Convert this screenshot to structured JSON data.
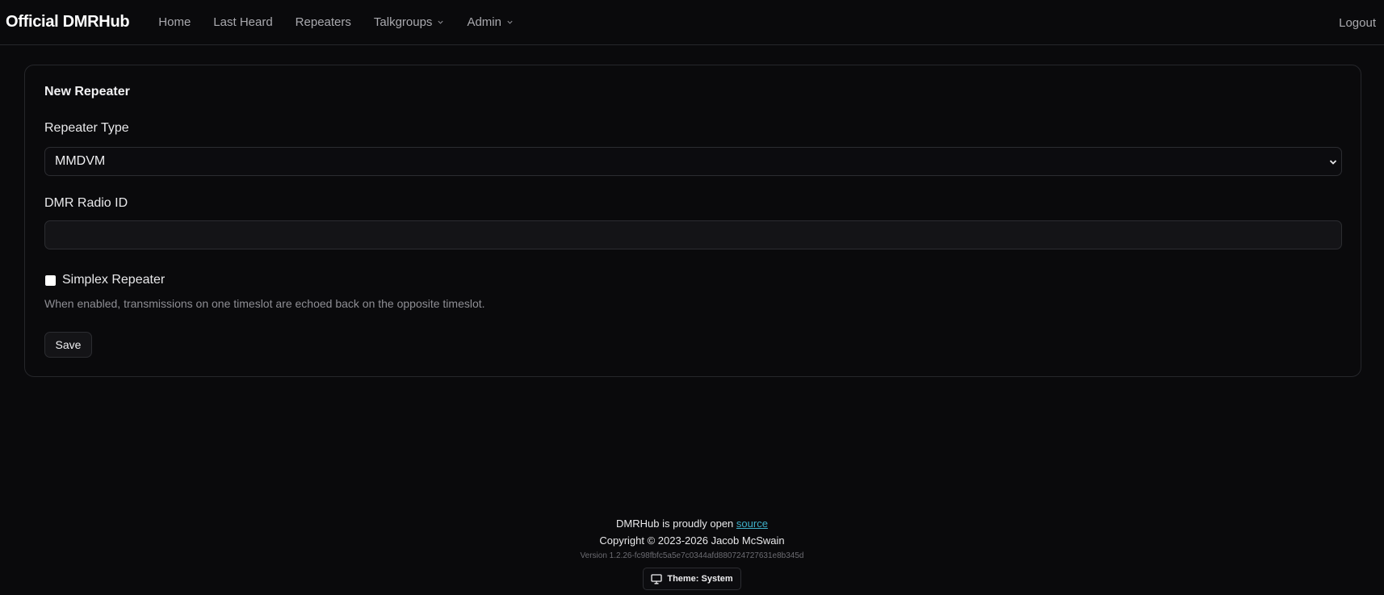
{
  "nav": {
    "brand": "Official DMRHub",
    "items": [
      {
        "label": "Home",
        "has_dropdown": false
      },
      {
        "label": "Last Heard",
        "has_dropdown": false
      },
      {
        "label": "Repeaters",
        "has_dropdown": false
      },
      {
        "label": "Talkgroups",
        "has_dropdown": true
      },
      {
        "label": "Admin",
        "has_dropdown": true
      }
    ],
    "logout": "Logout"
  },
  "form": {
    "title": "New Repeater",
    "repeater_type_label": "Repeater Type",
    "repeater_type_value": "MMDVM",
    "radio_id_label": "DMR Radio ID",
    "radio_id_value": "",
    "simplex_label": "Simplex Repeater",
    "simplex_checked": false,
    "simplex_help": "When enabled, transmissions on one timeslot are echoed back on the opposite timeslot.",
    "save_label": "Save"
  },
  "footer": {
    "open_source_text": "DMRHub is proudly open",
    "source_link": "source",
    "copyright": "Copyright © 2023-2026 Jacob McSwain",
    "version": "Version 1.2.26-fc98fbfc5a5e7c0344afd880724727631e8b345d",
    "theme_label": "Theme: System"
  },
  "colors": {
    "background": "#0a0a0c",
    "link": "#3fb0c9",
    "border": "#26272b"
  },
  "icons": {
    "dropdown": "chevron-down-icon",
    "theme": "monitor-icon"
  }
}
